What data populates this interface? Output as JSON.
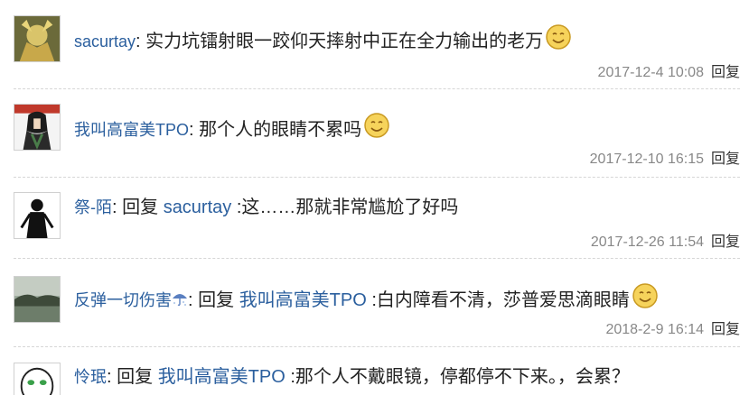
{
  "colors": {
    "username": "#2b5f9e",
    "text": "#222222",
    "meta": "#888888",
    "divider": "#d6d6d6"
  },
  "comments": [
    {
      "user": "sacurtay",
      "colon": ":",
      "text": " 实力坑镭射眼一跤仰天摔射中正在全力输出的老万",
      "emoji": "smile-emoji-icon",
      "time": "2017-12-4 10:08",
      "reply": "回复"
    },
    {
      "user": "我叫高富美TPO",
      "colon": ":",
      "text": " 那个人的眼睛不累吗",
      "emoji": "smile-emoji-icon",
      "time": "2017-12-10 16:15",
      "reply": "回复"
    },
    {
      "user": "祭-陌",
      "colon": ":",
      "reply_prefix": " 回复 ",
      "mention": "sacurtay",
      "text": " :这……那就非常尴尬了好吗",
      "time": "2017-12-26 11:54",
      "reply": "回复"
    },
    {
      "user": "反弹一切伤害",
      "user_icon": "umbrella-icon",
      "colon": ":",
      "reply_prefix": " 回复 ",
      "mention": "我叫高富美TPO",
      "text": " :白内障看不清，莎普爱思滴眼睛",
      "emoji": "smile-emoji-icon",
      "time": "2018-2-9 16:14",
      "reply": "回复"
    },
    {
      "user": "怜珉",
      "colon": ":",
      "reply_prefix": " 回复 ",
      "mention": "我叫高富美TPO",
      "text": " :那个人不戴眼镜，停都停不下来。，会累？"
    }
  ]
}
